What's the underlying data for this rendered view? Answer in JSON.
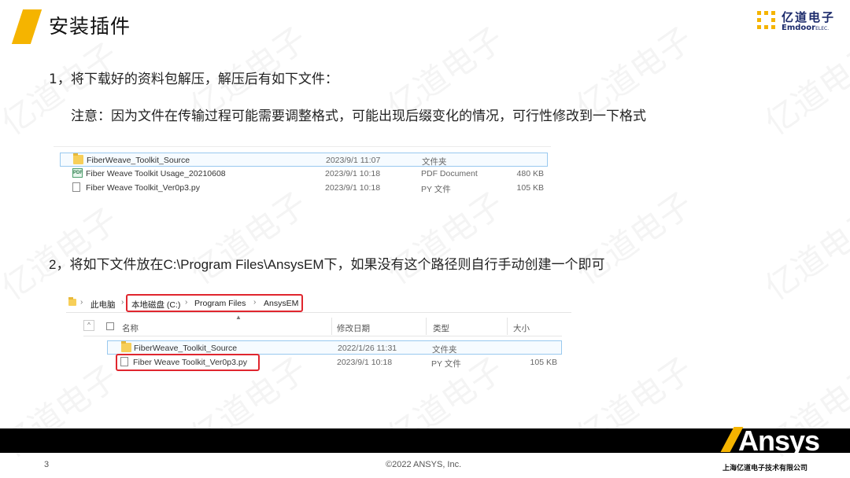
{
  "slide": {
    "title": "安装插件",
    "step1": "1，将下载好的资料包解压，解压后有如下文件：",
    "note": "注意：因为文件在传输过程可能需要调整格式，可能出现后缀变化的情况，可行性修改到一下格式",
    "step2": "2，将如下文件放在C:\\Program Files\\AnsysEM下，如果没有这个路径则自行手动创建一个即可"
  },
  "logo": {
    "cn": "亿道电子",
    "en": "Emdoor",
    "en_suffix": "ELEC."
  },
  "watermark_text": "亿道电子",
  "explorer1": {
    "files": [
      {
        "icon": "folder-icon",
        "name": "FiberWeave_Toolkit_Source",
        "date": "2023/9/1 11:07",
        "type": "文件夹",
        "size": ""
      },
      {
        "icon": "pdf-icon",
        "name": "Fiber Weave Toolkit Usage_20210608",
        "date": "2023/9/1 10:18",
        "type": "PDF Document",
        "size": "480 KB"
      },
      {
        "icon": "python-file-icon",
        "name": "Fiber Weave Toolkit_Ver0p3.py",
        "date": "2023/9/1 10:18",
        "type": "PY 文件",
        "size": "105 KB"
      }
    ]
  },
  "explorer2": {
    "breadcrumb": [
      "此电脑",
      "本地磁盘 (C:)",
      "Program Files",
      "AnsysEM"
    ],
    "headers": {
      "name": "名称",
      "modified": "修改日期",
      "type": "类型",
      "size": "大小"
    },
    "files": [
      {
        "icon": "folder-icon",
        "name": "FiberWeave_Toolkit_Source",
        "date": "2022/1/26 11:31",
        "type": "文件夹",
        "size": ""
      },
      {
        "icon": "python-file-icon",
        "name": "Fiber Weave Toolkit_Ver0p3.py",
        "date": "2023/9/1 10:18",
        "type": "PY 文件",
        "size": "105 KB"
      }
    ]
  },
  "footer": {
    "page_number": "3",
    "copyright": "©2022 ANSYS, Inc.",
    "brand": "Ansys",
    "company": "上海亿道电子技术有限公司"
  },
  "colors": {
    "accent": "#f5b400",
    "highlight": "#e0262e",
    "footer_bg": "#000000"
  }
}
